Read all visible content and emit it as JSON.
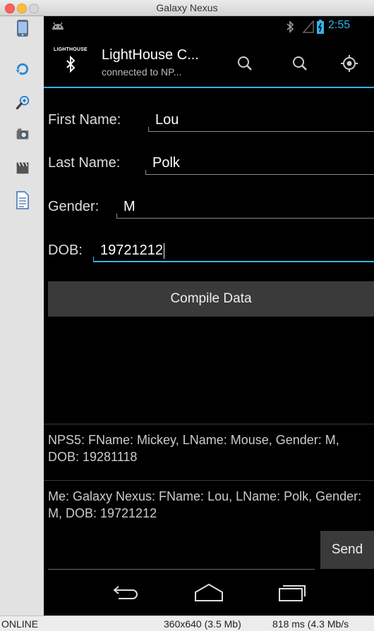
{
  "window": {
    "title": "Galaxy Nexus"
  },
  "sidebar": {
    "tools": [
      "device-icon",
      "rotate-icon",
      "zoom-icon",
      "camera-icon",
      "video-icon",
      "document-icon"
    ]
  },
  "statusbar": {
    "time": "2:55"
  },
  "actionbar": {
    "logo_text": "LIGHTHOUSE",
    "title": "LightHouse C...",
    "subtitle": "connected to NP..."
  },
  "form": {
    "first_name_label": "First Name:",
    "first_name_value": "Lou",
    "last_name_label": "Last Name:",
    "last_name_value": "Polk",
    "gender_label": "Gender:",
    "gender_value": "M",
    "dob_label": "DOB:",
    "dob_value": "19721212",
    "compile_button": "Compile Data"
  },
  "messages": [
    "NPS5:  FName: Mickey, LName: Mouse, Gender: M, DOB: 19281118",
    "Me: Galaxy Nexus: FName: Lou, LName: Polk, Gender: M, DOB: 19721212"
  ],
  "send_button": "Send",
  "footer": {
    "status": "ONLINE",
    "resolution": "360x640 (3.5 Mb)",
    "timing": "818 ms (4.3 Mb/s"
  },
  "colors": {
    "accent": "#33b5e5"
  }
}
